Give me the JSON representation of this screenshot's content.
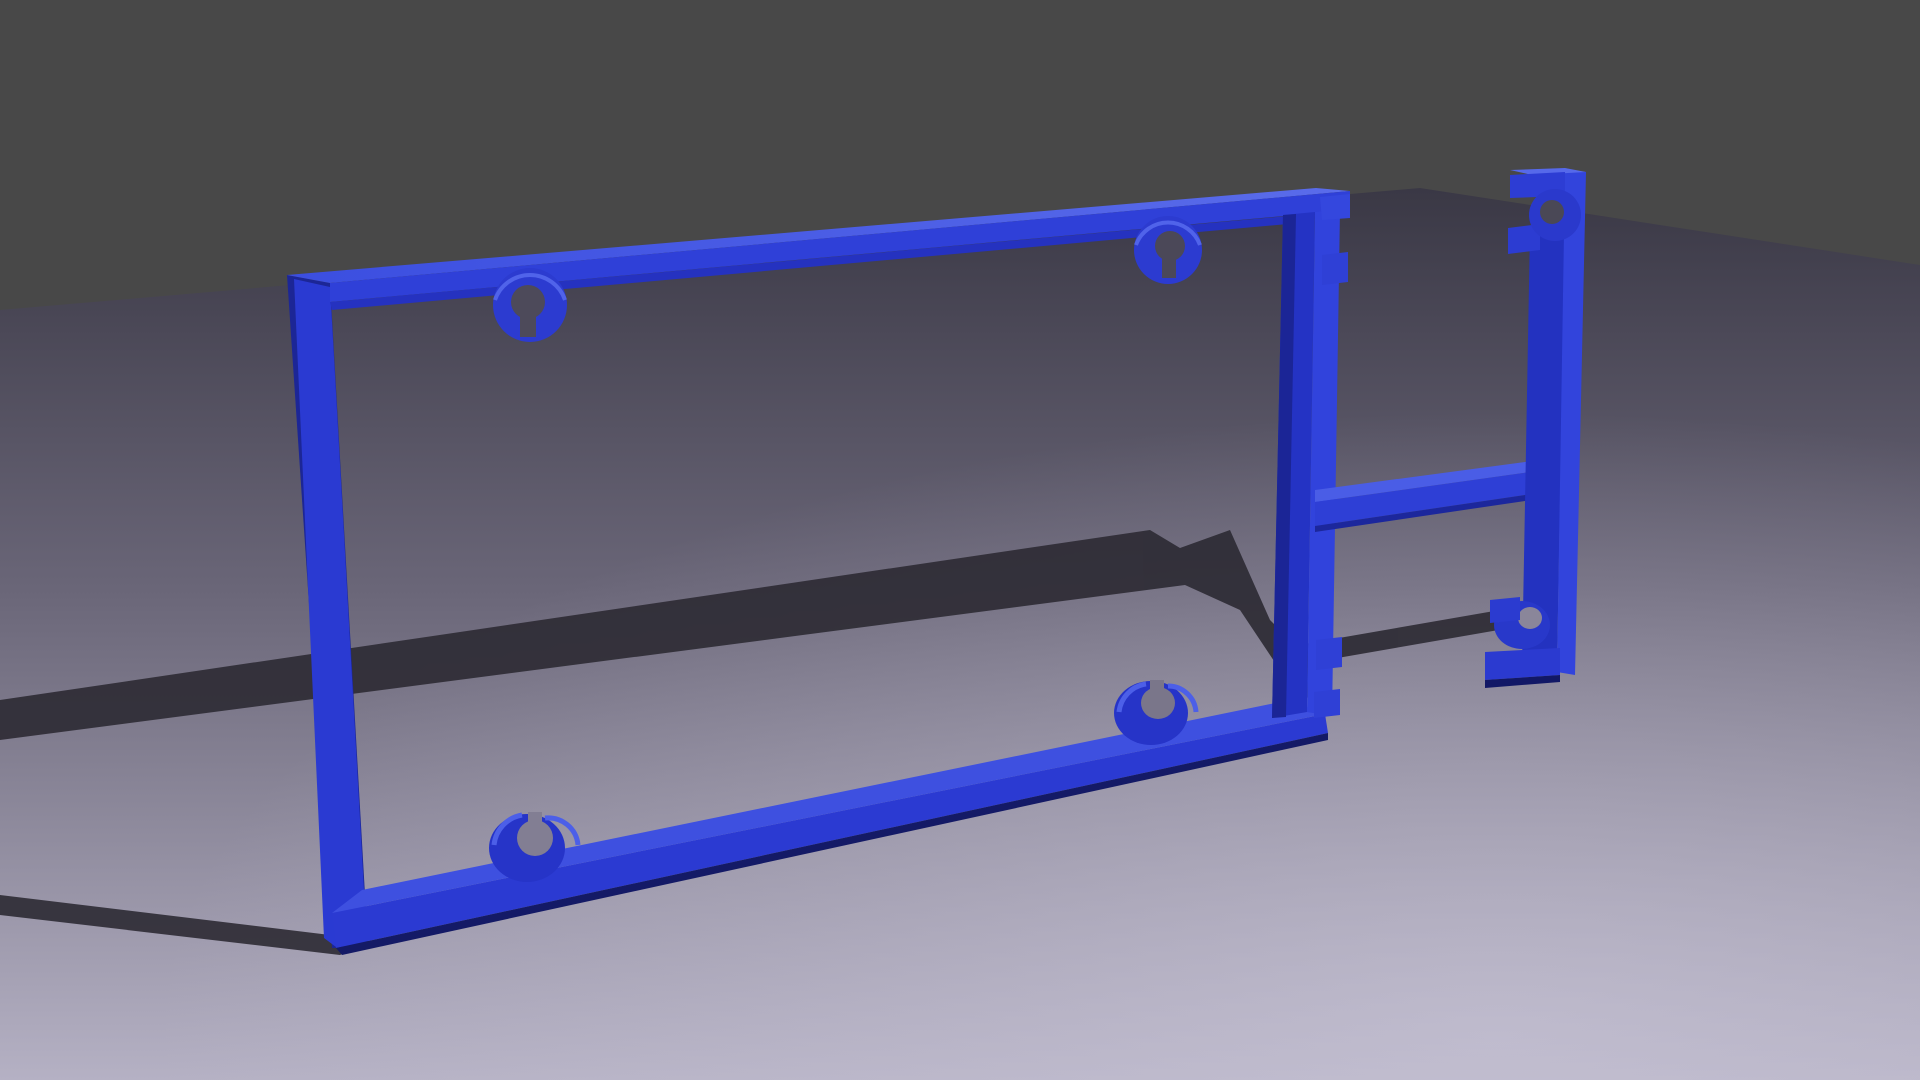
{
  "scene": {
    "subject": "3d-printed-blue-frame-render",
    "colors": {
      "backdrop": "#484848",
      "floor_far": "#3a3845",
      "floor_near": "#b5b1c4",
      "part": "#2e3fd9",
      "part_light": "#4f63e6",
      "part_dark": "#1b269a",
      "shadow": "#2a2930"
    },
    "objects": {
      "main_frame": {
        "name": "main-frame",
        "clip_count": 4,
        "side_tab_count": 2
      },
      "side_rail": {
        "name": "side-rail",
        "clip_count": 2
      }
    }
  }
}
